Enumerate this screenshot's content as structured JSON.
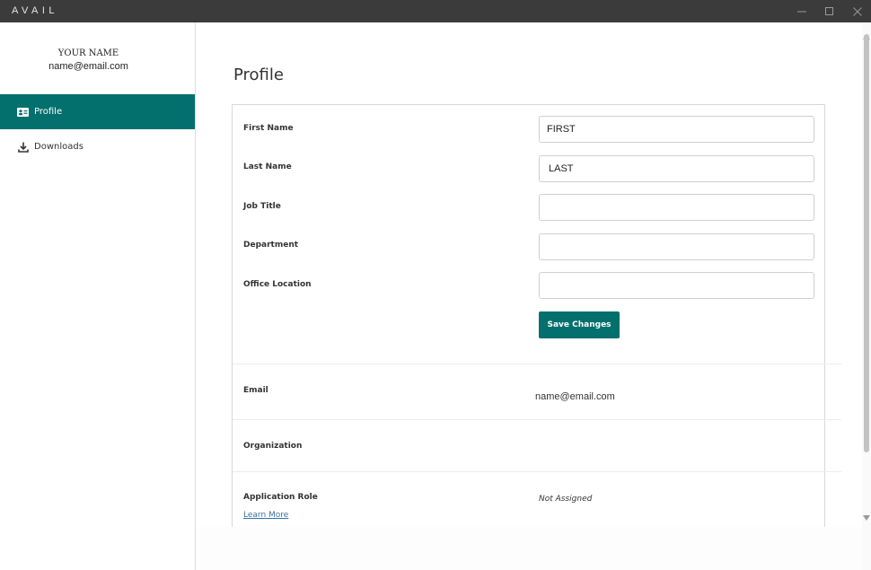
{
  "window": {
    "title": "AVAIL"
  },
  "sidebar": {
    "user_name": "YOUR NAME",
    "user_email": "name@email.com",
    "items": [
      {
        "label": "Profile",
        "icon": "id-card-icon",
        "active": true
      },
      {
        "label": "Downloads",
        "icon": "download-icon",
        "active": false
      }
    ]
  },
  "main": {
    "title": "Profile",
    "form": {
      "first_name": {
        "label": "First Name",
        "value": "FIRST"
      },
      "last_name": {
        "label": "Last Name",
        "value": "LAST"
      },
      "job_title": {
        "label": "Job Title",
        "value": ""
      },
      "department": {
        "label": "Department",
        "value": ""
      },
      "office_location": {
        "label": "Office Location",
        "value": ""
      },
      "save_label": "Save Changes"
    },
    "info": {
      "email": {
        "label": "Email",
        "value": "name@email.com"
      },
      "organization": {
        "label": "Organization",
        "value": ""
      },
      "application_role": {
        "label": "Application Role",
        "value": "Not Assigned",
        "link": "Learn More"
      }
    }
  },
  "colors": {
    "accent": "#04706d",
    "titlebar": "#3b3b3b",
    "link": "#3a6ea5"
  }
}
